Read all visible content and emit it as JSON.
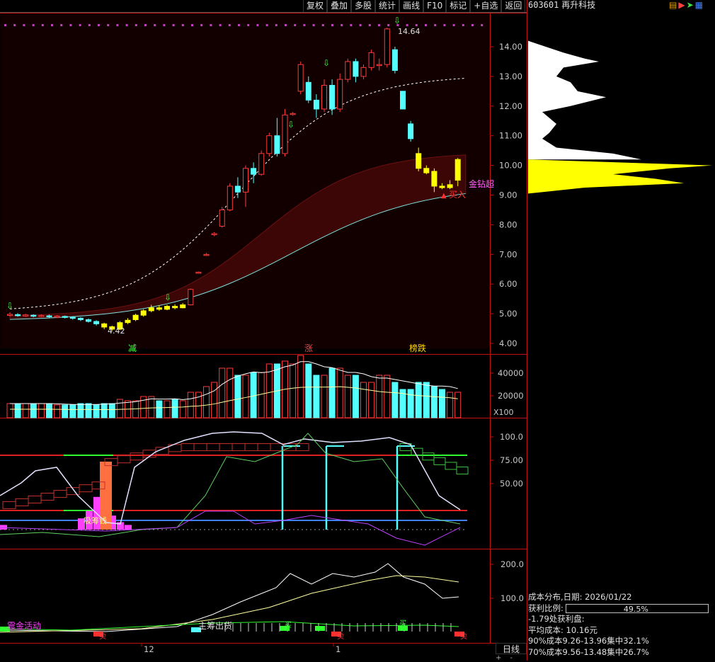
{
  "toolbar": {
    "items": [
      "复权",
      "叠加",
      "多股",
      "统计",
      "画线",
      "F10",
      "标记",
      "+自选",
      "返回"
    ]
  },
  "stock": {
    "code": "603601",
    "name": "再升科技"
  },
  "colors": {
    "up": "#ff3b3b",
    "down": "#54ffff",
    "yellow": "#ffff00",
    "bg": "#000000",
    "axis": "#c01010",
    "magenta": "#d040d0",
    "band": "#3a0808"
  },
  "main_axis": {
    "min": 4.0,
    "max": 14.0,
    "ticks": [
      "14.00",
      "13.00",
      "12.00",
      "11.00",
      "10.00",
      "9.00",
      "8.00",
      "7.00",
      "6.00",
      "5.00",
      "4.00"
    ]
  },
  "main_labels": {
    "high": "14.64",
    "low": "4.42",
    "signal": "金钻超",
    "buy": "买入"
  },
  "events": [
    "减",
    "涨",
    "榜跌"
  ],
  "volume_axis": {
    "ticks": [
      "40000",
      "20000"
    ],
    "unit": "X100"
  },
  "kdj_axis": {
    "ticks": [
      "100.0",
      "75.00",
      "50.00"
    ]
  },
  "kdj_labels": {
    "money": "吸筹钱"
  },
  "lower_axis": {
    "ticks": [
      "200.0",
      "100.0"
    ]
  },
  "lower_labels": {
    "left": "震金活动",
    "mid": "主筹出货",
    "buy_marks": [
      "买",
      "买"
    ],
    "sell_marks": [
      "卖",
      "卖",
      "卖"
    ]
  },
  "x_labels": [
    "12",
    "1"
  ],
  "period": "日线",
  "scroll": [
    "+",
    "-"
  ],
  "cost": {
    "title": "成本分布,日期: 2026/01/22",
    "profit_label": "获利比例:",
    "profit_value": "49.5%",
    "profit_fraction": 0.495,
    "line1": "-1.79处获利盘:",
    "line2": "平均成本: 10.16元",
    "line3": "90%成本9.26-13.96集中32.1%",
    "line4": "70%成本9.56-13.48集中26.7%"
  },
  "candles": [
    [
      4.95,
      4.98,
      5.05,
      4.9
    ],
    [
      4.97,
      4.95,
      5.02,
      4.9
    ],
    [
      4.94,
      4.96,
      5.0,
      4.9
    ],
    [
      4.95,
      4.92,
      4.98,
      4.88
    ],
    [
      4.92,
      4.94,
      4.98,
      4.88
    ],
    [
      4.93,
      4.9,
      4.97,
      4.86
    ],
    [
      4.9,
      4.92,
      4.95,
      4.85
    ],
    [
      4.91,
      4.89,
      4.94,
      4.84
    ],
    [
      4.88,
      4.85,
      4.92,
      4.8
    ],
    [
      4.85,
      4.8,
      4.88,
      4.75
    ],
    [
      4.8,
      4.74,
      4.84,
      4.7
    ],
    [
      4.74,
      4.66,
      4.78,
      4.6
    ],
    [
      4.66,
      4.55,
      4.7,
      4.48
    ],
    [
      4.56,
      4.48,
      4.6,
      4.42
    ],
    [
      4.48,
      4.7,
      4.75,
      4.45
    ],
    [
      4.7,
      4.78,
      4.85,
      4.65
    ],
    [
      4.8,
      4.95,
      5.0,
      4.75
    ],
    [
      4.95,
      5.1,
      5.15,
      4.9
    ],
    [
      5.1,
      5.2,
      5.3,
      5.05
    ],
    [
      5.2,
      5.15,
      5.28,
      5.1
    ],
    [
      5.15,
      5.25,
      5.3,
      5.12
    ],
    [
      5.25,
      5.2,
      5.32,
      5.15
    ],
    [
      5.2,
      5.3,
      5.36,
      5.18
    ],
    [
      5.3,
      5.82,
      5.85,
      5.28
    ],
    [
      6.38,
      6.4,
      6.42,
      6.35
    ],
    [
      6.98,
      7.0,
      7.05,
      6.95
    ],
    [
      7.68,
      7.7,
      7.75,
      7.62
    ],
    [
      7.95,
      8.5,
      8.6,
      7.9
    ],
    [
      8.5,
      9.3,
      9.4,
      8.45
    ],
    [
      9.3,
      9.1,
      9.6,
      8.9
    ],
    [
      9.1,
      9.9,
      10.0,
      8.6
    ],
    [
      9.9,
      9.7,
      10.1,
      9.4
    ],
    [
      9.7,
      10.4,
      10.5,
      9.65
    ],
    [
      10.4,
      11.0,
      11.1,
      10.3
    ],
    [
      11.0,
      10.4,
      11.6,
      10.3
    ],
    [
      10.4,
      11.7,
      11.9,
      10.3
    ],
    [
      11.72,
      11.75,
      11.8,
      11.68
    ],
    [
      12.5,
      13.4,
      13.5,
      12.4
    ],
    [
      12.8,
      12.2,
      13.0,
      12.1
    ],
    [
      12.2,
      11.9,
      12.4,
      11.6
    ],
    [
      11.9,
      12.7,
      12.9,
      11.8
    ],
    [
      12.7,
      11.9,
      12.9,
      11.7
    ],
    [
      11.9,
      12.9,
      13.1,
      11.8
    ],
    [
      12.9,
      13.5,
      13.6,
      12.8
    ],
    [
      13.5,
      13.0,
      13.6,
      12.8
    ],
    [
      13.0,
      13.3,
      13.4,
      12.9
    ],
    [
      13.3,
      13.8,
      13.9,
      13.2
    ],
    [
      13.4,
      13.4,
      13.6,
      13.2
    ],
    [
      13.4,
      14.6,
      14.64,
      13.3
    ],
    [
      13.9,
      13.2,
      14.0,
      13.1
    ],
    [
      12.5,
      11.9,
      12.5,
      11.9
    ],
    [
      11.4,
      10.9,
      11.5,
      10.8
    ],
    [
      10.4,
      9.9,
      10.6,
      9.8
    ],
    [
      9.9,
      9.75,
      10.0,
      9.7
    ],
    [
      9.8,
      9.3,
      9.9,
      9.1
    ],
    [
      9.3,
      9.25,
      9.4,
      9.2
    ],
    [
      9.25,
      9.35,
      9.5,
      9.2
    ],
    [
      9.5,
      10.2,
      10.25,
      9.3
    ]
  ],
  "volumes": [
    10,
    10,
    10,
    10,
    10,
    10,
    9,
    9,
    9,
    10,
    10,
    9,
    10,
    10,
    13,
    12,
    12,
    15,
    15,
    12,
    12,
    13,
    12,
    18,
    18,
    22,
    25,
    35,
    35,
    30,
    30,
    32,
    32,
    38,
    38,
    40,
    38,
    44,
    38,
    30,
    30,
    35,
    35,
    30,
    30,
    25,
    25,
    30,
    30,
    25,
    20,
    20,
    25,
    25,
    22,
    20,
    18,
    18
  ]
}
